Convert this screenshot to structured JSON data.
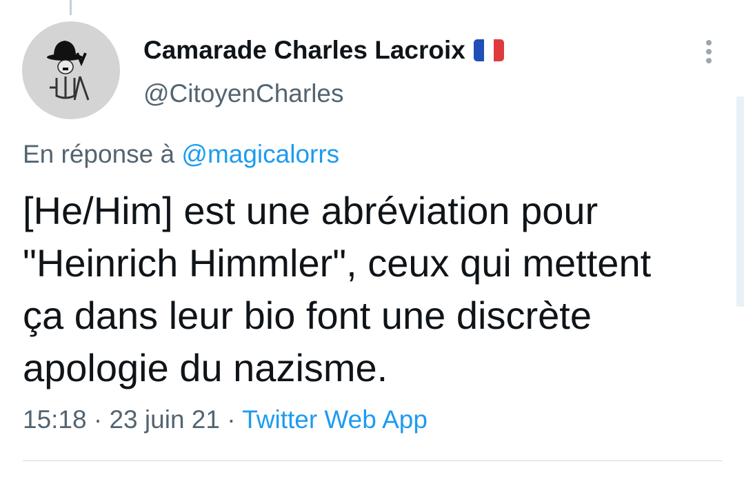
{
  "author": {
    "display_name": "Camarade Charles Lacroix",
    "flag_icon": "france-flag-icon",
    "handle": "@CitoyenCharles"
  },
  "reply": {
    "prefix": "En réponse à",
    "mention": "@magicalorrs"
  },
  "tweet": {
    "lines": [
      "[He/Him] est une abréviation pour",
      "\"Heinrich Himmler\", ceux qui mettent",
      "ça dans leur bio font une discrète",
      "apologie du nazisme."
    ]
  },
  "meta": {
    "time": "15:18",
    "separator": "·",
    "date": "23 juin 21",
    "source": "Twitter Web App"
  },
  "colors": {
    "text": "#0f1419",
    "secondary": "#536471",
    "link": "#1d9bf0",
    "flag_blue": "#1f4fb7",
    "flag_white": "#ffffff",
    "flag_red": "#e03a3e"
  }
}
